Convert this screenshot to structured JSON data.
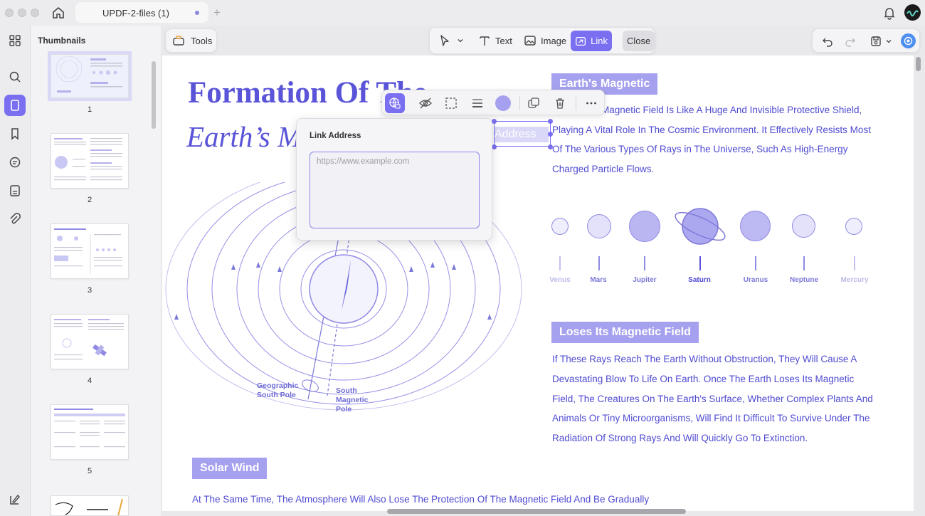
{
  "window": {
    "tab_title": "UPDF-2-files (1)"
  },
  "sidebar": {
    "panel_title": "Thumbnails",
    "pages": [
      "1",
      "2",
      "3",
      "4",
      "5"
    ]
  },
  "toolbar": {
    "tools_label": "Tools",
    "text_label": "Text",
    "image_label": "Image",
    "link_label": "Link",
    "close_label": "Close"
  },
  "link_popover": {
    "title": "Link Address",
    "placeholder": "https://www.example.com",
    "value": ""
  },
  "selected_text": "Address",
  "document": {
    "title_line1": "Formation Of The",
    "title_line2": "Earth’s M",
    "section1_heading": "Earth's Magnetic",
    "section1_lines": [
      "Magnetic Field Is Like A Huge And Invisible Protective Shield,",
      "Playing A Vital Role In The Cosmic Environment. It Effectively Resists Most",
      "Of The Various Types Of Rays in The Universe, Such As High-Energy",
      "Charged Particle Flows."
    ],
    "planets": [
      "Venus",
      "Mars",
      "Jupiter",
      "Saturn",
      "Uranus",
      "Neptune",
      "Mercury"
    ],
    "pole_label_geo": [
      "Geographic",
      "South Pole"
    ],
    "pole_label_south": [
      "South",
      "Magnetic",
      "Pole"
    ],
    "section2_heading": "Loses Its Magnetic Field",
    "section2_lines": [
      "If These Rays Reach The Earth Without Obstruction, They Will Cause A",
      "Devastating Blow To Life On Earth. Once The Earth Loses Its Magnetic",
      "Field, The Creatures On The Earth's Surface, Whether Complex Plants And",
      "Animals Or Tiny Microorganisms, Will Find It Difficult To Survive Under The",
      "Radiation Of Strong Rays And Will Quickly Go To Extinction."
    ],
    "section3_heading": "Solar Wind",
    "section3_line": "At The Same Time, The Atmosphere Will Also Lose The Protection Of The Magnetic Field And Be Gradually"
  },
  "colors": {
    "accent": "#7a6ff0",
    "doc_text": "#4e4ad0",
    "badge": "#a6a1ee"
  }
}
